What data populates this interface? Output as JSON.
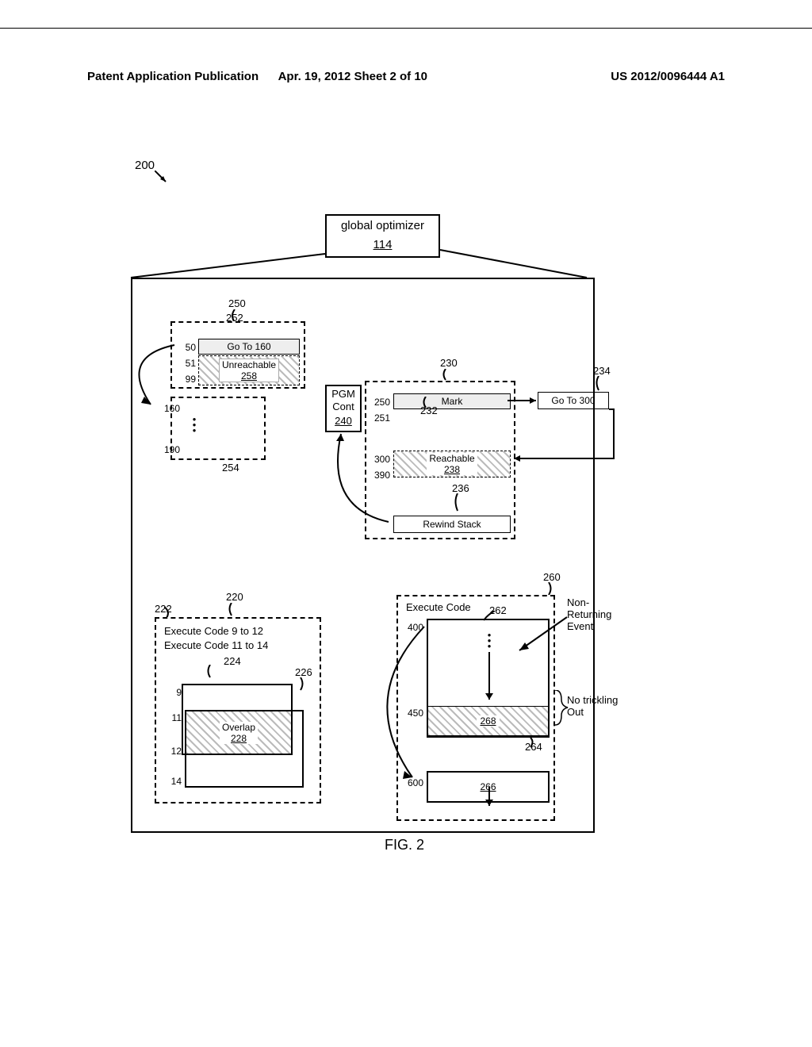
{
  "header": {
    "left": "Patent Application Publication",
    "mid": "Apr. 19, 2012  Sheet 2 of 10",
    "right": "US 2012/0096444 A1"
  },
  "figure": {
    "caption": "FIG. 2",
    "ref_main": "200",
    "optimizer": {
      "title": "global optimizer",
      "ref": "114"
    },
    "box250": {
      "ref": "250",
      "topinner_ref": "252",
      "goto_label": "Go To 160",
      "unreachable_label": "Unreachable",
      "unreachable_ref": "258",
      "row50": "50",
      "row51": "51",
      "row99": "99",
      "row160": "160",
      "row190": "190",
      "lower_ref": "254"
    },
    "box230": {
      "ref": "230",
      "pgm_label": "PGM",
      "cont_label": "Cont",
      "pgm_ref": "240",
      "mark_label": "Mark",
      "mark_ref": "232",
      "row250": "250",
      "row251": "251",
      "reachable_label": "Reachable",
      "reachable_ref": "238",
      "row300": "300",
      "row390": "390",
      "rewind_label": "Rewind Stack",
      "rewind_ref": "236",
      "goto300_label": "Go To 300",
      "goto300_ref": "234"
    },
    "box220": {
      "ref": "220",
      "ref222": "222",
      "line1": "Execute Code  9 to 12",
      "line2": "Execute Code  11 to 14",
      "ref224": "224",
      "ref226": "226",
      "overlap_label": "Overlap",
      "overlap_ref": "228",
      "row9": "9",
      "row11": "11",
      "row12": "12",
      "row14": "14"
    },
    "box260": {
      "ref": "260",
      "title": "Execute Code",
      "ref262": "262",
      "row400": "400",
      "ref268": "268",
      "row450": "450",
      "ref264": "264",
      "ref266": "266",
      "row600": "600",
      "annot1": "Non-\nReturning\nEvent",
      "annot2": "No trickling\nOut"
    }
  }
}
